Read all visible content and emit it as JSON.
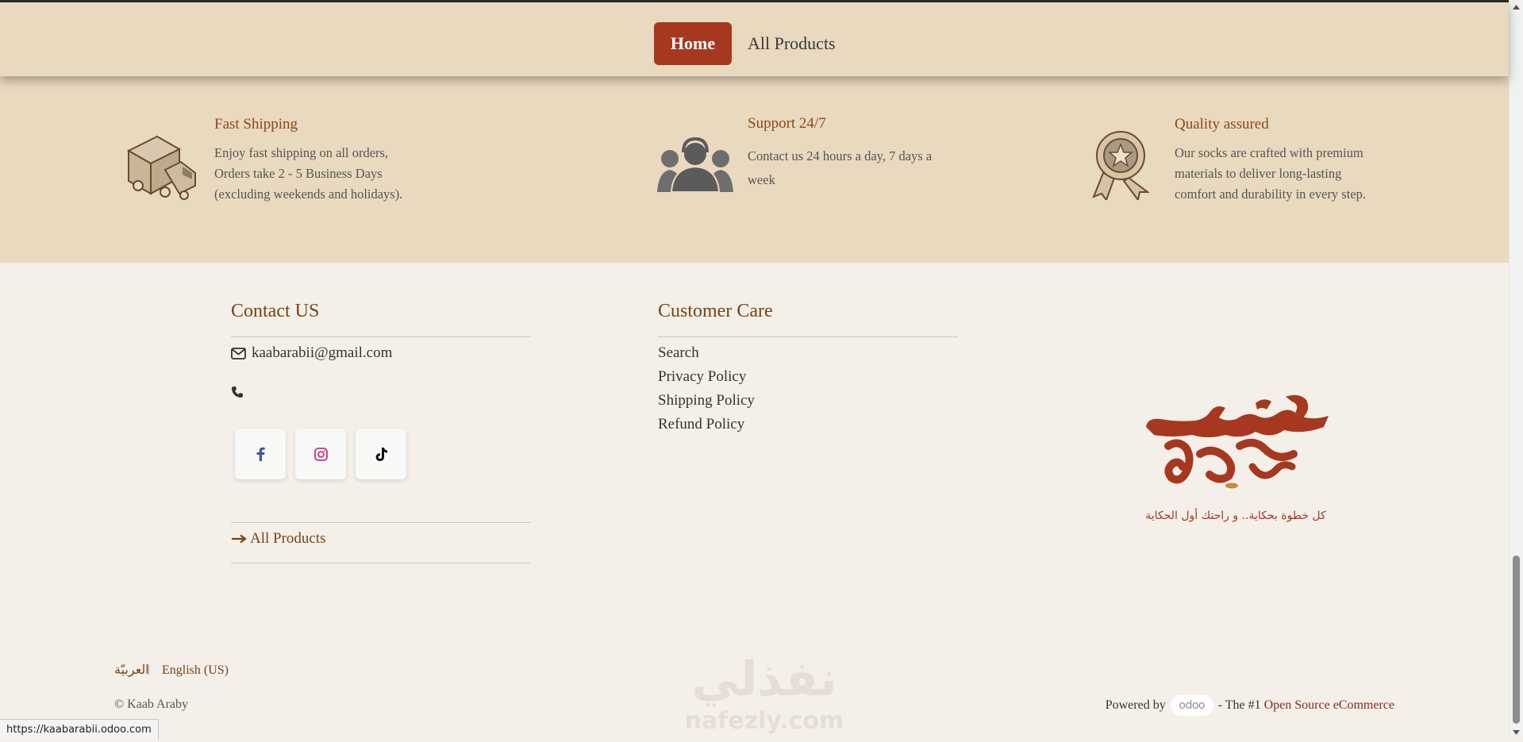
{
  "nav": {
    "home_label": "Home",
    "all_products_label": "All Products"
  },
  "features": [
    {
      "title": "Fast Shipping",
      "desc": [
        "Enjoy fast shipping on all orders,",
        "Orders take 2 - 5 Business Days",
        "(excluding weekends and holidays)."
      ],
      "icon": "delivery-truck-icon"
    },
    {
      "title": "Support 24/7",
      "desc": [
        "Contact us 24 hours a day, 7 days a",
        "week"
      ],
      "icon": "support-agents-icon"
    },
    {
      "title": "Quality assured",
      "desc": [
        "Our socks are crafted with premium",
        "materials to deliver long-lasting",
        "comfort and durability in every step."
      ],
      "icon": "quality-badge-icon"
    }
  ],
  "contact": {
    "title": "Contact US",
    "email": "kaabarabii@gmail.com",
    "all_products_link": "All Products",
    "social": [
      "facebook-icon",
      "instagram-icon",
      "tiktok-icon"
    ]
  },
  "customer_care": {
    "title": "Customer Care",
    "links": [
      "Search",
      "Privacy Policy",
      "Shipping Policy",
      "Refund Policy"
    ]
  },
  "logo": {
    "tagline": "كل خطوة بحكاية.. و راحتك أول الحكاية",
    "mark": "كعب عربي"
  },
  "footer": {
    "lang_ar": "العربيّة",
    "lang_sep": "|",
    "lang_en": "English (US)",
    "copyright": "© Kaab Araby",
    "powered_by": "Powered by",
    "odoo": "odoo",
    "the_1": "- The #1",
    "oss_link": "Open Source eCommerce"
  },
  "watermark": {
    "arabic": "نفذلي",
    "latin": "nafezly.com"
  },
  "status_bar": {
    "url": "https://kaabarabii.odoo.com"
  },
  "colors": {
    "accent": "#a6381f",
    "band": "#e9d9bf",
    "footer_bg": "#f4f0e9",
    "heading": "#7a4213"
  }
}
